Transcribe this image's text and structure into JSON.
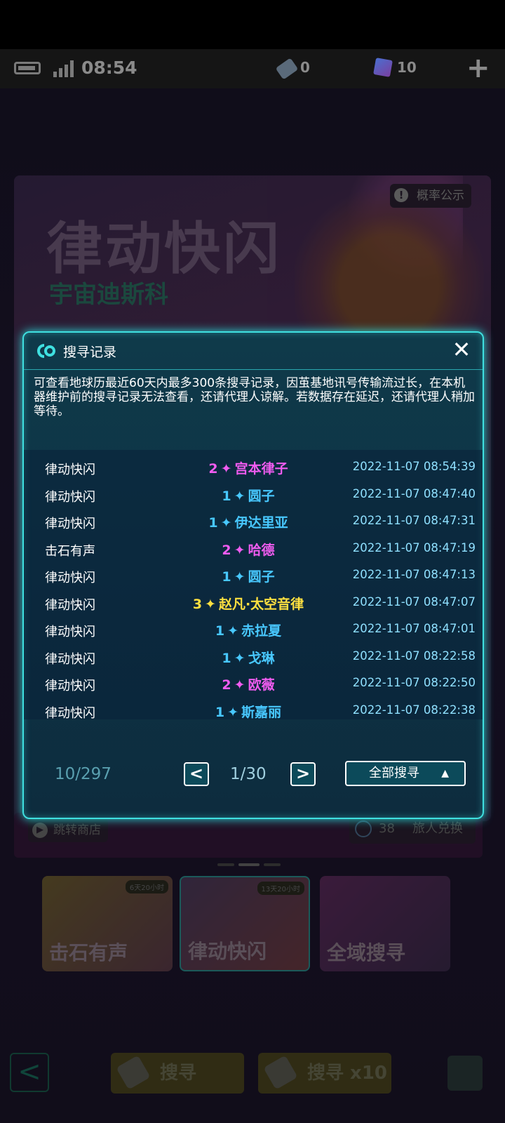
{
  "status_bar": {
    "time": "08:54",
    "ticket_count": "0",
    "gem_count": "10",
    "add": "+"
  },
  "banner": {
    "title": "律动快闪",
    "subtitle": "宇宙迪斯科",
    "probability_label": "概率公示",
    "warn_glyph": "!"
  },
  "shop": {
    "jump_label": "跳转商店",
    "exchange_count": "38",
    "exchange_label": "旅人兑换"
  },
  "pools": [
    {
      "name": "击石有声",
      "tag": "6天20小时"
    },
    {
      "name": "律动快闪",
      "tag": "13天20小时"
    },
    {
      "name": "全域搜寻",
      "tag": ""
    }
  ],
  "bottom": {
    "search_one": "搜寻",
    "search_ten": "搜寻 x10",
    "back_glyph": "<"
  },
  "dialog": {
    "title": "搜寻记录",
    "close_glyph": "✕",
    "notice": "可查看地球历最近60天内最多300条搜寻记录，因茧基地讯号传输流过长，在本机器维护前的搜寻记录无法查看，还请代理人谅解。若数据存在延迟，还请代理人稍加等待。",
    "records": [
      {
        "pool": "律动快闪",
        "stars": "2",
        "name": "宫本律子",
        "time": "2022-11-07 08:54:39",
        "rarity_color": "#f05cf0"
      },
      {
        "pool": "律动快闪",
        "stars": "1",
        "name": "圆子",
        "time": "2022-11-07 08:47:40",
        "rarity_color": "#48c8ff"
      },
      {
        "pool": "律动快闪",
        "stars": "1",
        "name": "伊达里亚",
        "time": "2022-11-07 08:47:31",
        "rarity_color": "#48c8ff"
      },
      {
        "pool": "击石有声",
        "stars": "2",
        "name": "哈德",
        "time": "2022-11-07 08:47:19",
        "rarity_color": "#f05cf0"
      },
      {
        "pool": "律动快闪",
        "stars": "1",
        "name": "圆子",
        "time": "2022-11-07 08:47:13",
        "rarity_color": "#48c8ff"
      },
      {
        "pool": "律动快闪",
        "stars": "3",
        "name": "赵凡·太空音律",
        "time": "2022-11-07 08:47:07",
        "rarity_color": "#ffe040"
      },
      {
        "pool": "律动快闪",
        "stars": "1",
        "name": "赤拉夏",
        "time": "2022-11-07 08:47:01",
        "rarity_color": "#48c8ff"
      },
      {
        "pool": "律动快闪",
        "stars": "1",
        "name": "戈琳",
        "time": "2022-11-07 08:22:58",
        "rarity_color": "#48c8ff"
      },
      {
        "pool": "律动快闪",
        "stars": "2",
        "name": "欧薇",
        "time": "2022-11-07 08:22:50",
        "rarity_color": "#f05cf0"
      },
      {
        "pool": "律动快闪",
        "stars": "1",
        "name": "斯嘉丽",
        "time": "2022-11-07 08:22:38",
        "rarity_color": "#48c8ff"
      }
    ],
    "star_glyph": "✦",
    "total": "10/297",
    "page": "1/30",
    "prev_glyph": "<",
    "next_glyph": ">",
    "filter_label": "全部搜寻",
    "filter_caret": "▲"
  },
  "colors": {
    "accent": "#3fe0e0",
    "rarity_1": "#48c8ff",
    "rarity_2": "#f05cf0",
    "rarity_3": "#ffe040"
  }
}
